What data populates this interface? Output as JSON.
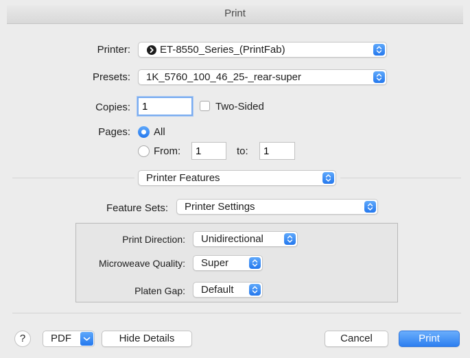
{
  "window": {
    "title": "Print"
  },
  "printer": {
    "label": "Printer:",
    "value": "ET-8550_Series_(PrintFab)",
    "icon": "printer-status-icon"
  },
  "presets": {
    "label": "Presets:",
    "value": "1K_5760_100_46_25-_rear-super"
  },
  "copies": {
    "label": "Copies:",
    "value": "1",
    "two_sided_label": "Two-Sided",
    "two_sided_checked": false
  },
  "pages": {
    "label": "Pages:",
    "all_label": "All",
    "from_label": "From:",
    "from_value": "1",
    "to_label": "to:",
    "to_value": "1",
    "selected": "All"
  },
  "section_popup": {
    "value": "Printer Features"
  },
  "feature_sets": {
    "label": "Feature Sets:",
    "value": "Printer Settings"
  },
  "settings": [
    {
      "label": "Print Direction:",
      "value": "Unidirectional"
    },
    {
      "label": "Microweave Quality:",
      "value": "Super"
    },
    {
      "label": "Platen Gap:",
      "value": "Default"
    }
  ],
  "footer": {
    "help_label": "?",
    "pdf_label": "PDF",
    "hide_details_label": "Hide Details",
    "cancel_label": "Cancel",
    "print_label": "Print"
  },
  "colors": {
    "accent": "#2d7ff0",
    "background": "#ececec"
  }
}
